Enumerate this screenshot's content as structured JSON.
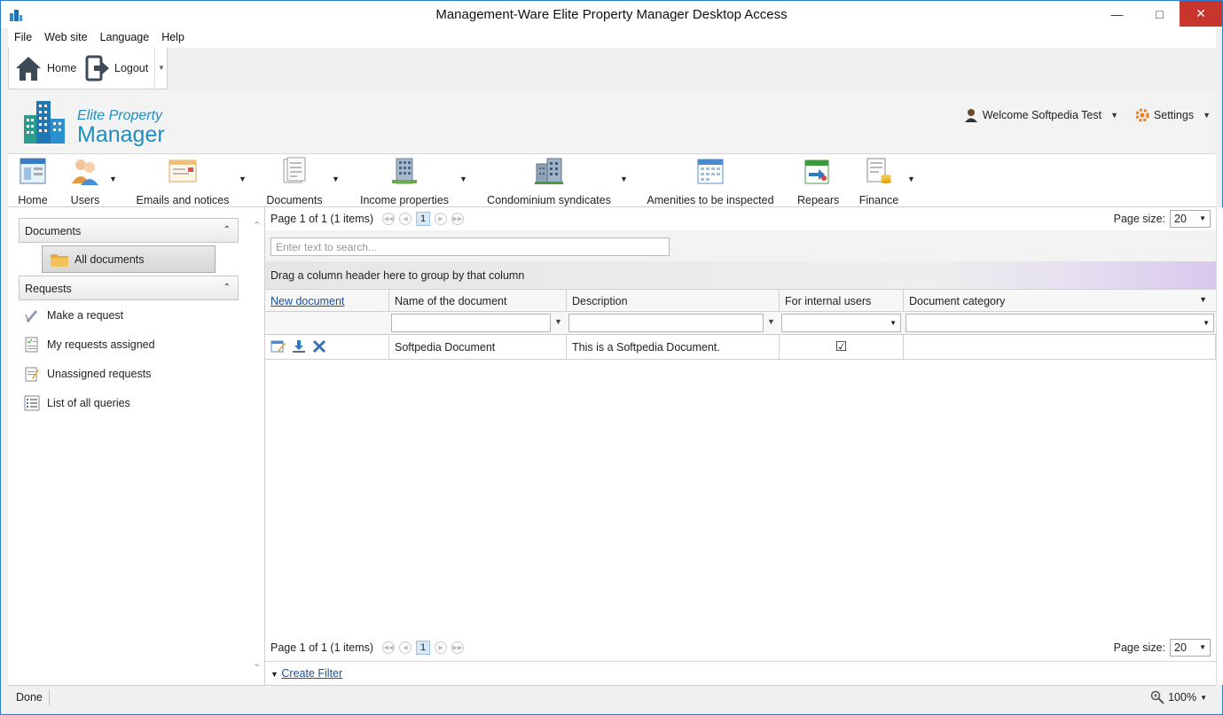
{
  "window": {
    "title": "Management-Ware Elite Property Manager Desktop Access"
  },
  "menu": [
    "File",
    "Web site",
    "Language",
    "Help"
  ],
  "quick": {
    "home": "Home",
    "logout": "Logout"
  },
  "logo": {
    "line1": "Elite Property",
    "line2": "Manager"
  },
  "user": {
    "welcome": "Welcome Softpedia Test",
    "settings": "Settings"
  },
  "ribbon": {
    "home": "Home",
    "users": "Users",
    "emails": "Emails and notices",
    "documents": "Documents",
    "income": "Income properties",
    "condo": "Condominium syndicates",
    "amenities": "Amenities to be inspected",
    "repears": "Repears",
    "finance": "Finance"
  },
  "sidebar": {
    "documents_group": "Documents",
    "all_documents": "All documents",
    "requests_group": "Requests",
    "requests": [
      "Make a request",
      "My requests assigned",
      "Unassigned requests",
      "List of all queries"
    ]
  },
  "grid": {
    "pager_text": "Page 1 of 1 (1 items)",
    "page_num": "1",
    "page_size_label": "Page size:",
    "page_size": "20",
    "search_placeholder": "Enter text to search...",
    "group_panel": "Drag a column header here to group by that column",
    "headers": {
      "new_document": "New document",
      "name": "Name of the document",
      "description": "Description",
      "internal": "For internal users",
      "category": "Document category"
    },
    "row": {
      "name": "Softpedia Document",
      "description": "This is a Softpedia Document.",
      "internal": "☑",
      "category": ""
    },
    "create_filter": "Create Filter"
  },
  "status": {
    "text": "Done",
    "zoom": "100%"
  }
}
